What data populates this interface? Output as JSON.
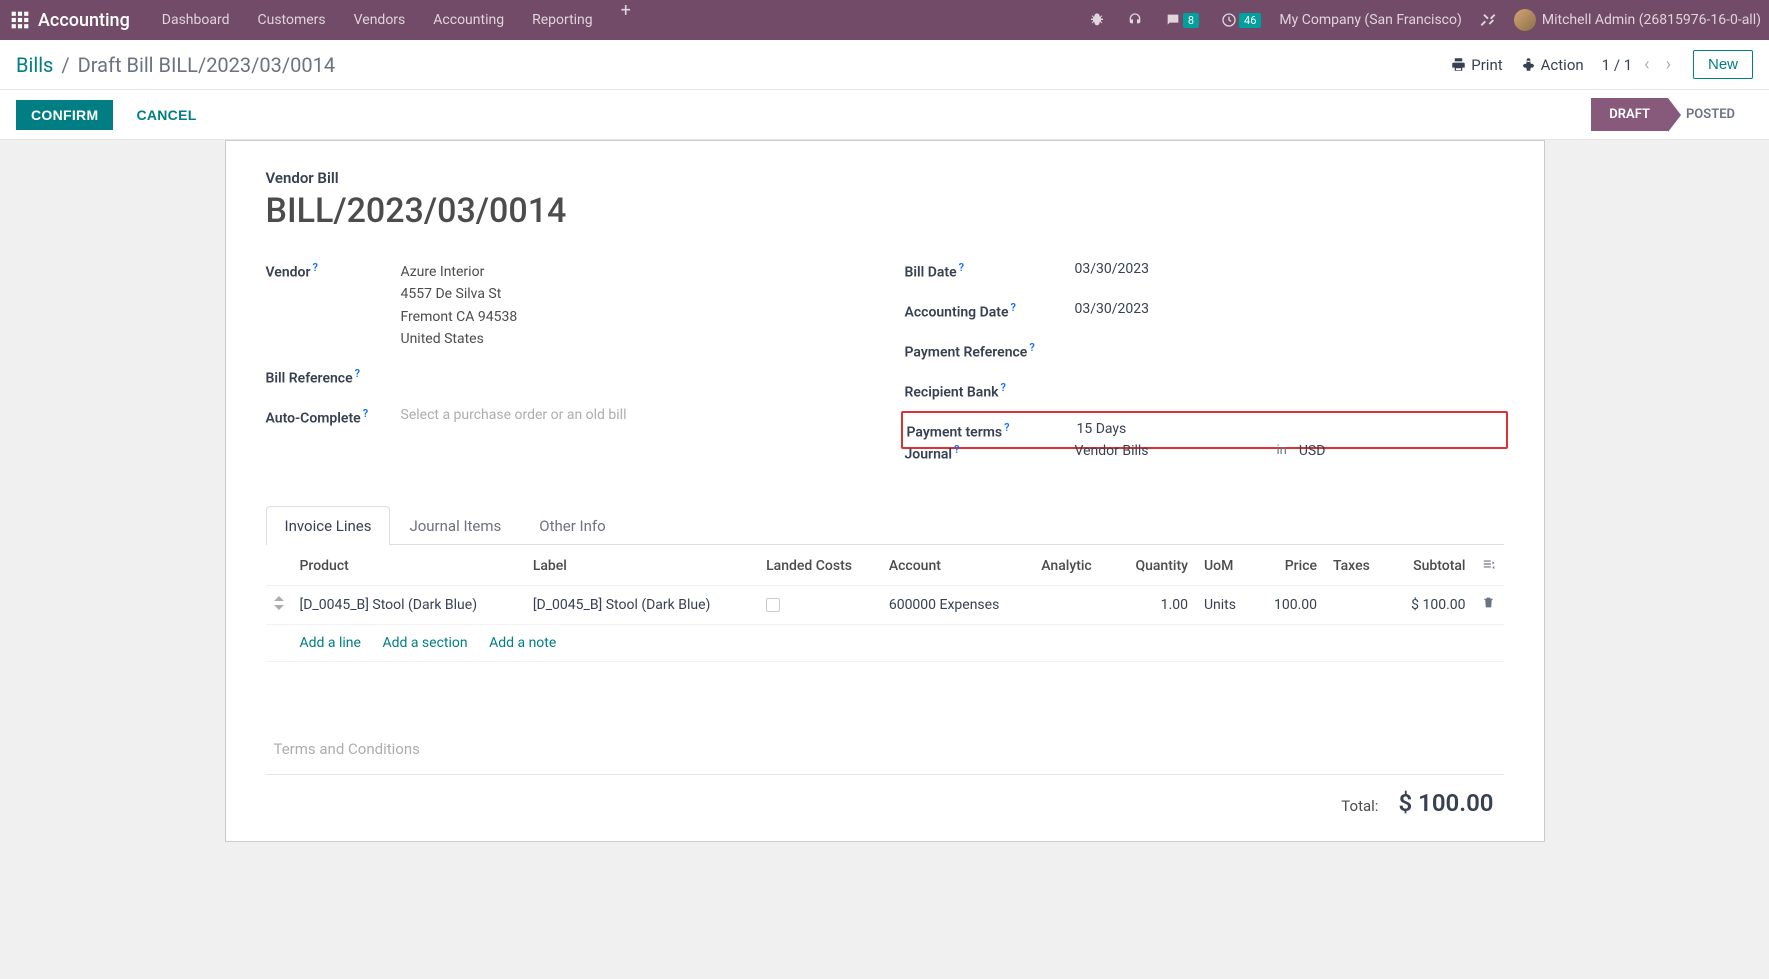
{
  "nav": {
    "brand": "Accounting",
    "links": [
      "Dashboard",
      "Customers",
      "Vendors",
      "Accounting",
      "Reporting"
    ],
    "messaging_badge": "8",
    "activity_badge": "46",
    "company": "My Company (San Francisco)",
    "user": "Mitchell Admin (26815976-16-0-all)"
  },
  "breadcrumb": {
    "parent": "Bills",
    "current": "Draft Bill BILL/2023/03/0014",
    "print": "Print",
    "action": "Action",
    "pager": "1 / 1",
    "new_btn": "New"
  },
  "actions": {
    "confirm": "CONFIRM",
    "cancel": "CANCEL",
    "status_draft": "DRAFT",
    "status_posted": "POSTED"
  },
  "doc": {
    "subtitle": "Vendor Bill",
    "title": "BILL/2023/03/0014"
  },
  "left_fields": {
    "vendor_label": "Vendor",
    "vendor_name": "Azure Interior",
    "vendor_addr1": "4557 De Silva St",
    "vendor_addr2": "Fremont CA 94538",
    "vendor_addr3": "United States",
    "bill_ref_label": "Bill Reference",
    "bill_ref_value": "",
    "autocomplete_label": "Auto-Complete",
    "autocomplete_placeholder": "Select a purchase order or an old bill"
  },
  "right_fields": {
    "bill_date_label": "Bill Date",
    "bill_date_value": "03/30/2023",
    "accounting_date_label": "Accounting Date",
    "accounting_date_value": "03/30/2023",
    "payment_ref_label": "Payment Reference",
    "payment_ref_value": "",
    "recipient_bank_label": "Recipient Bank",
    "recipient_bank_value": "",
    "payment_terms_label": "Payment terms",
    "payment_terms_value": "15 Days",
    "journal_label": "Journal",
    "journal_value": "Vendor Bills",
    "journal_in": "in",
    "journal_currency": "USD"
  },
  "tabs": {
    "t1": "Invoice Lines",
    "t2": "Journal Items",
    "t3": "Other Info"
  },
  "table": {
    "h_product": "Product",
    "h_label": "Label",
    "h_landed": "Landed Costs",
    "h_account": "Account",
    "h_analytic": "Analytic",
    "h_qty": "Quantity",
    "h_uom": "UoM",
    "h_price": "Price",
    "h_taxes": "Taxes",
    "h_subtotal": "Subtotal",
    "row1": {
      "product": "[D_0045_B] Stool (Dark Blue)",
      "label": "[D_0045_B] Stool (Dark Blue)",
      "account": "600000 Expenses",
      "qty": "1.00",
      "uom": "Units",
      "price": "100.00",
      "subtotal": "$ 100.00"
    },
    "add_line": "Add a line",
    "add_section": "Add a section",
    "add_note": "Add a note"
  },
  "footer": {
    "terms_placeholder": "Terms and Conditions",
    "total_label": "Total:",
    "total_value": "$ 100.00"
  }
}
